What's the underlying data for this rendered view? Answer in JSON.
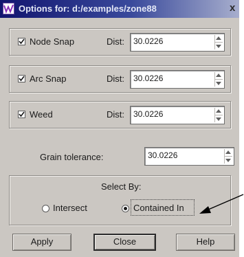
{
  "window": {
    "title": "Options for: d:/examples/zone88",
    "close_glyph": "x"
  },
  "snaps": [
    {
      "label": "Node Snap",
      "checked": true,
      "dist_label": "Dist:",
      "value": "30.0226"
    },
    {
      "label": "Arc Snap",
      "checked": true,
      "dist_label": "Dist:",
      "value": "30.0226"
    },
    {
      "label": "Weed",
      "checked": true,
      "dist_label": "Dist:",
      "value": "30.0226"
    }
  ],
  "grain": {
    "label": "Grain tolerance:",
    "value": "30.0226"
  },
  "select_by": {
    "title": "Select By:",
    "options": [
      {
        "label": "Intersect",
        "selected": false
      },
      {
        "label": "Contained In",
        "selected": true
      }
    ]
  },
  "buttons": {
    "apply": "Apply",
    "close": "Close",
    "help": "Help"
  },
  "icons": {
    "app": "app-logo-icon",
    "checkmark": "checkmark-icon",
    "spin": "spinner-arrows-icon",
    "annotation": "arrow-pointer"
  }
}
